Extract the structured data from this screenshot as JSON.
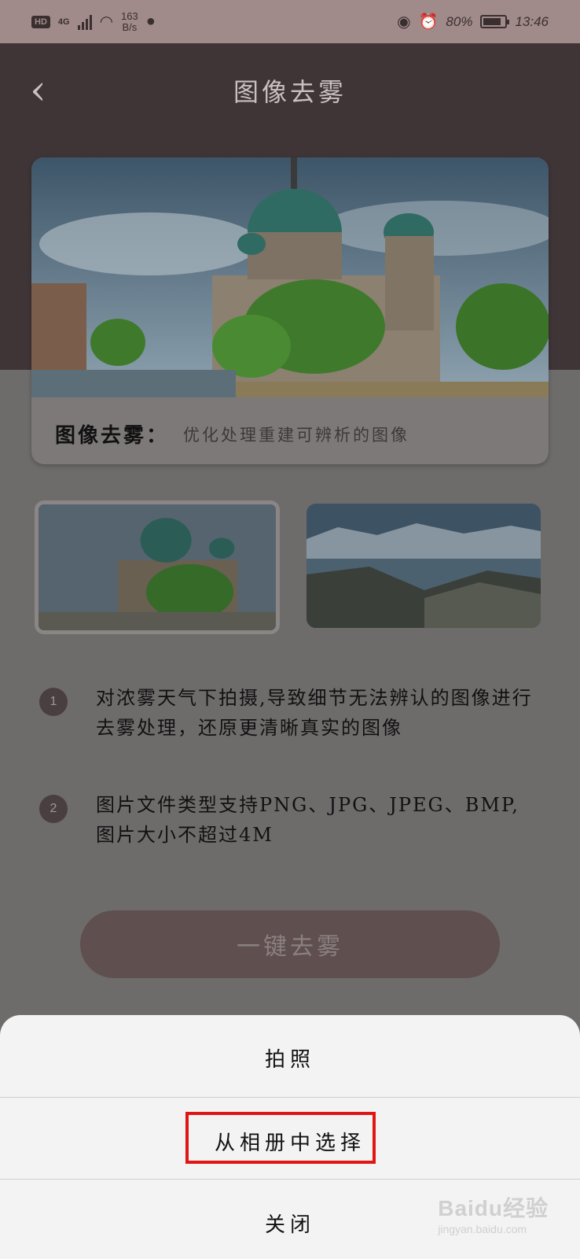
{
  "status_bar": {
    "network": "4G",
    "hd": "HD",
    "speed_value": "163",
    "speed_unit": "B/s",
    "battery": "80%",
    "time": "13:46",
    "battery_level": 0.8
  },
  "header": {
    "back_label": "‹",
    "title": "图像去雾"
  },
  "hero": {
    "caption_title": "图像去雾：",
    "caption_desc": "优化处理重建可辨析的图像"
  },
  "steps": [
    {
      "num": "1",
      "text": "对浓雾天气下拍摄,导致细节无法辨认的图像进行去雾处理，还原更清晰真实的图像"
    },
    {
      "num": "2",
      "text": "图片文件类型支持PNG、JPG、JPEG、BMP,图片大小不超过4M"
    }
  ],
  "action_button": "一键去雾",
  "sheet": {
    "take_photo": "拍照",
    "choose_album": "从相册中选择",
    "close": "关闭"
  },
  "watermark": {
    "text": "Baidu经验",
    "sub": "jingyan.baidu.com"
  },
  "colors": {
    "header": "#3f3536",
    "overlay": "#6e6b6b",
    "highlight": "#e01515"
  }
}
